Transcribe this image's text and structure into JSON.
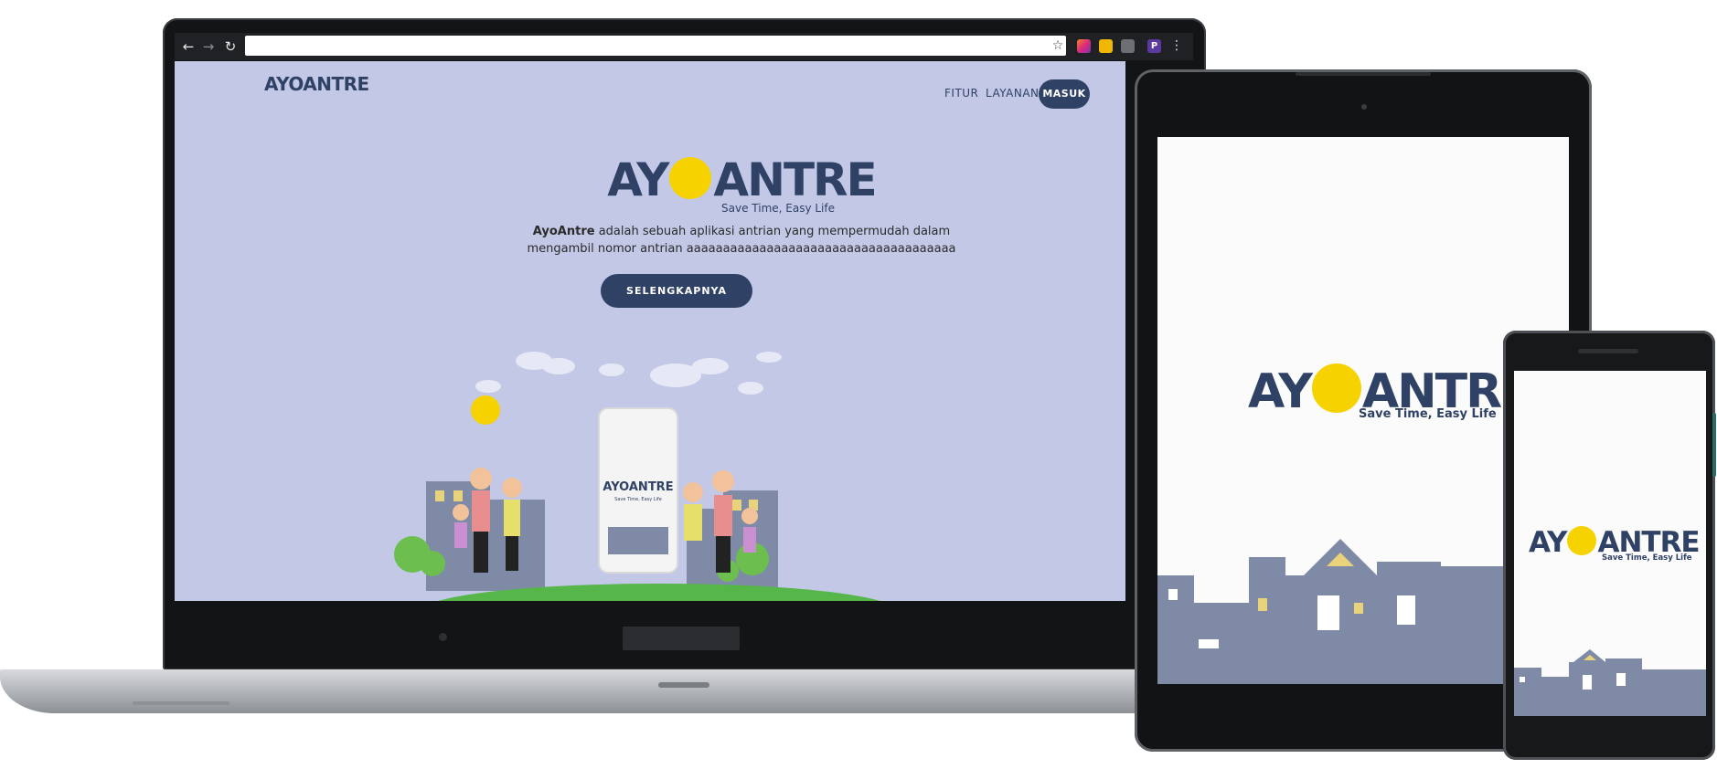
{
  "browser": {
    "back_icon": "arrow-left-icon",
    "forward_icon": "arrow-right-icon",
    "reload_icon": "reload-icon",
    "bookmark_icon": "star-icon",
    "menu_icon": "vertical-dots-icon",
    "url": ""
  },
  "site": {
    "nav": {
      "logo_text": "AYOANTRE",
      "links": [
        "FITUR",
        "LAYANAN"
      ],
      "login_label": "MASUK"
    },
    "hero": {
      "logo_left": "AY",
      "logo_right": "ANTRE",
      "tagline": "Save  Time, Easy Life",
      "brand_name": "AyoAntre",
      "description_rest": " adalah sebuah aplikasi antrian yang mempermudah dalam",
      "description_line2": "mengambil nomor antrian aaaaaaaaaaaaaaaaaaaaaaaaaaaaaaaaaaaaa",
      "cta_label": "SELENGKAPNYA"
    },
    "illustration": {
      "phone_logo": "AYOANTRE",
      "phone_tagline": "Save  Time, Easy Life"
    }
  },
  "tablet": {
    "logo_left": "AY",
    "logo_right": "ANTRE",
    "tagline": "Save  Time, Easy Life"
  },
  "phone": {
    "logo_left": "AY",
    "logo_right": "ANTRE",
    "tagline": "Save  Time, Easy Life"
  },
  "colors": {
    "brand_navy": "#2f4266",
    "brand_yellow": "#f6d200",
    "hero_bg": "#c2c8e6",
    "city_gray": "#7e8aa6"
  }
}
